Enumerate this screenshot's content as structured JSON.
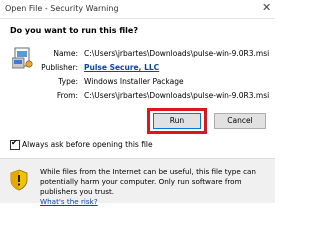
{
  "window": {
    "title": "Open File - Security Warning",
    "close_glyph": "✕"
  },
  "question": "Do you want to run this file?",
  "details": [
    {
      "label": "Name:",
      "value": "C:\\Users\\jrbartes\\Downloads\\pulse-win-9.0R3.msi"
    },
    {
      "label": "Publisher:",
      "value": "Pulse Secure, LLC"
    },
    {
      "label": "Type:",
      "value": "Windows Installer Package"
    },
    {
      "label": "From:",
      "value": "C:\\Users\\jrbartes\\Downloads\\pulse-win-9.0R3.msi"
    }
  ],
  "buttons": {
    "run": "Run",
    "cancel": "Cancel"
  },
  "checkbox": {
    "label": "Always ask before opening this file",
    "checked": true,
    "mark": "✔"
  },
  "info": {
    "text": "While files from the Internet can be useful, this file type can potentially harm your computer. Only run software from publishers you trust.",
    "link": "What's the risk?"
  },
  "colors": {
    "highlight": "#e0141e",
    "link": "#0645ad"
  },
  "icons": {
    "file": "installer-file-icon",
    "shield": "warning-shield-icon"
  }
}
